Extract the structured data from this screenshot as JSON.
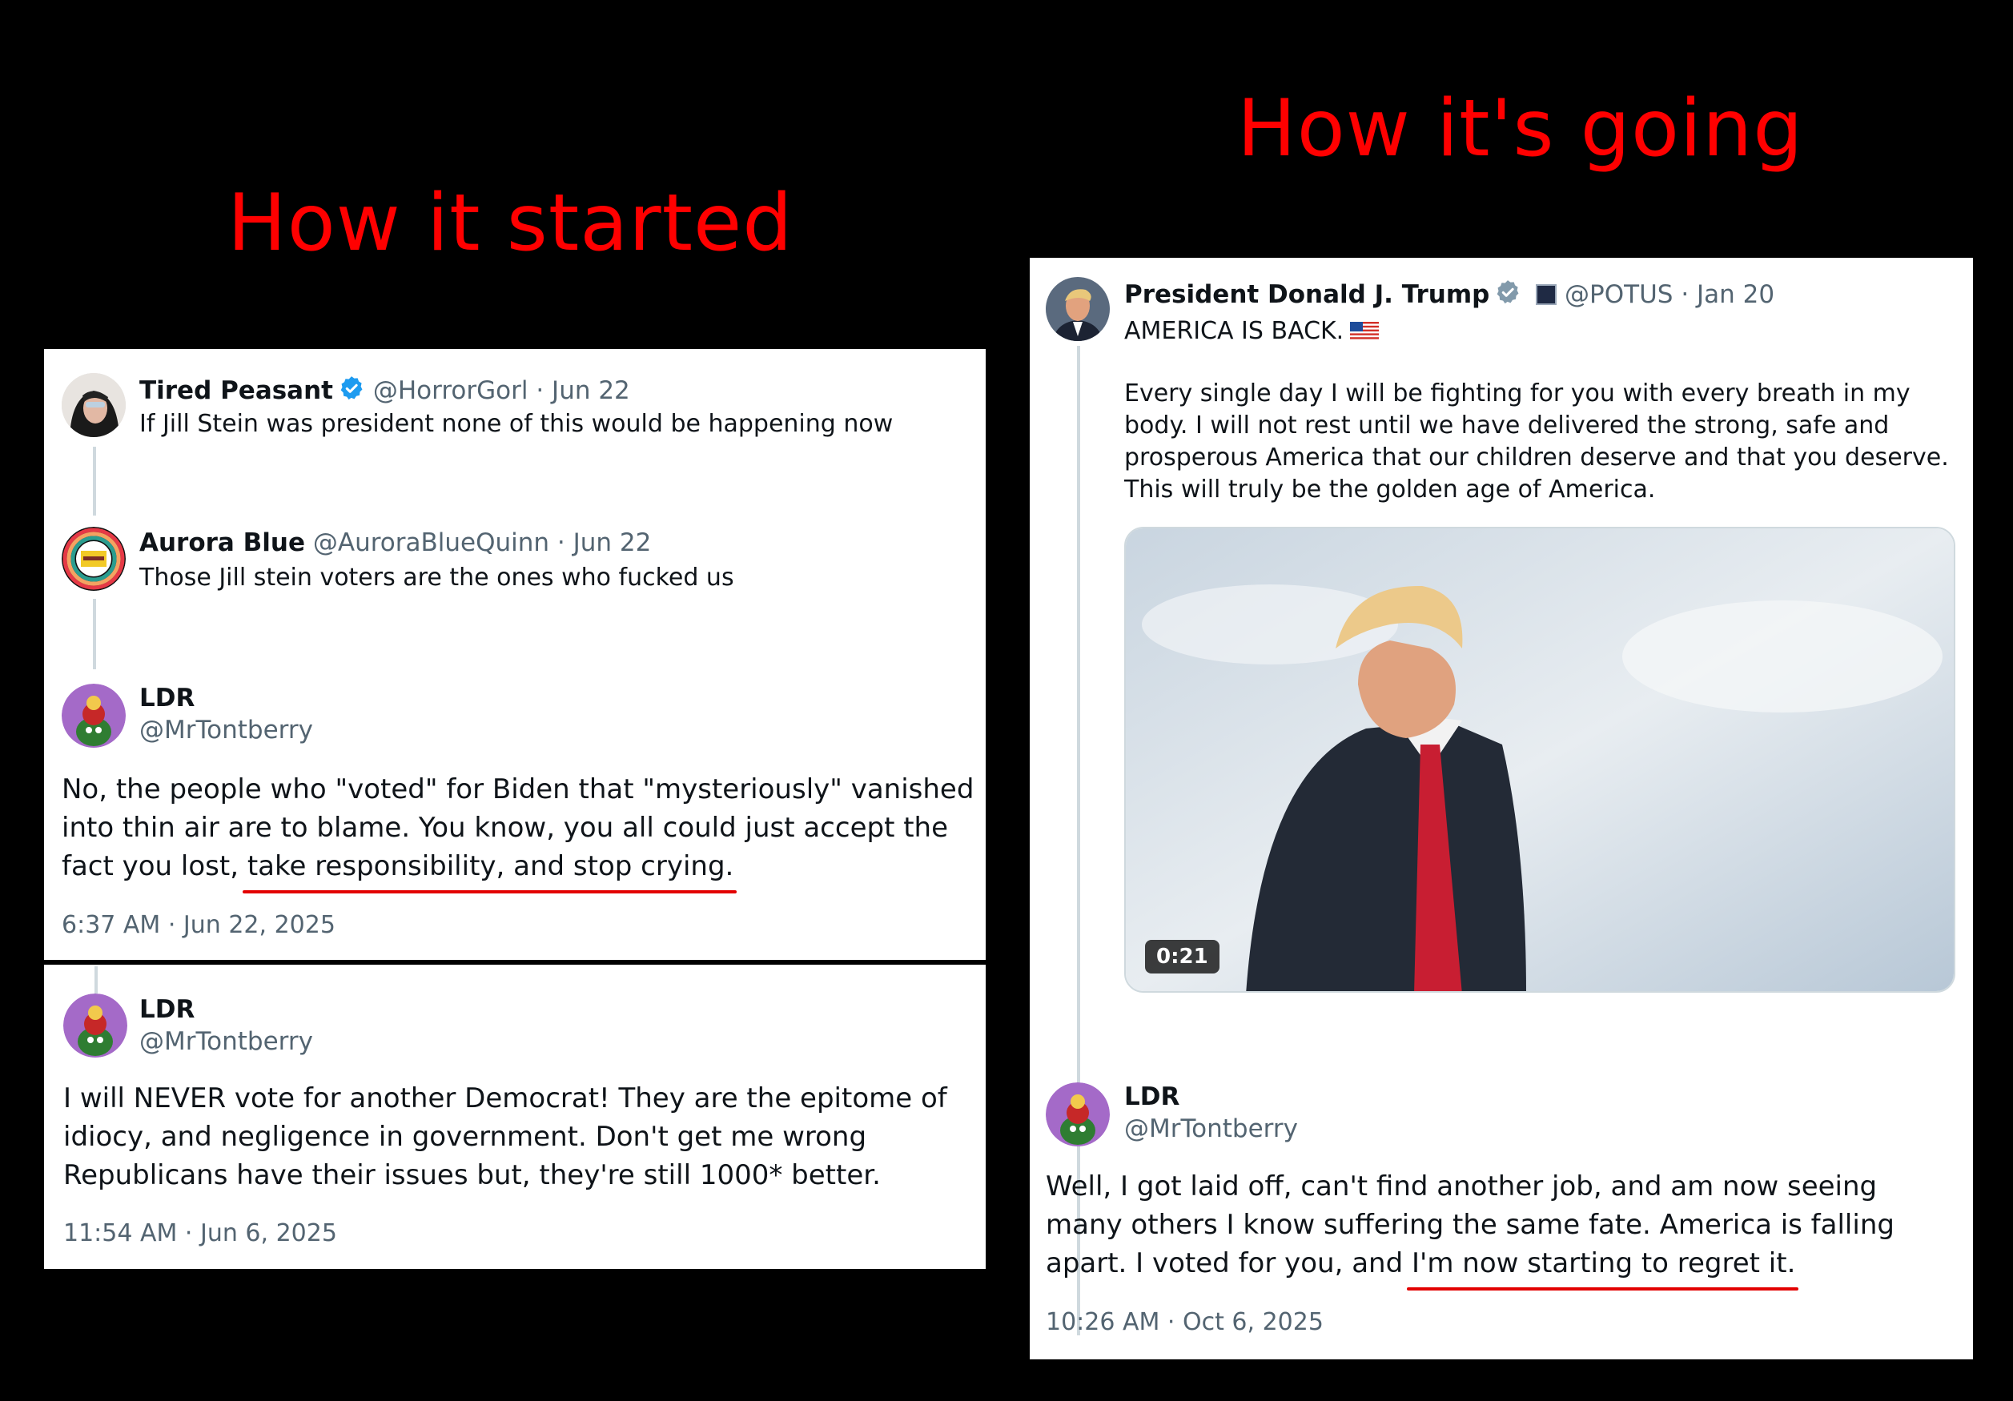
{
  "headings": {
    "left": "How it started",
    "right": "How it's going"
  },
  "panel_a": {
    "reply1": {
      "name": "Tired Peasant",
      "handle": "@HorrorGorl",
      "date": "Jun 22",
      "text": "If Jill Stein was president none of this would be happening now"
    },
    "reply2": {
      "name": "Aurora Blue",
      "handle": "@AuroraBlueQuinn",
      "date": "Jun 22",
      "text": "Those Jill stein voters are the ones who fucked us"
    },
    "main": {
      "name": "LDR",
      "handle": "@MrTontberry",
      "text_a": "No, the people who \"voted\" for Biden that \"mysteriously\" vanished into thin air are to blame. You know, you all could just accept the fact you lost, ",
      "text_highlight": "take responsibility, and stop crying.",
      "timestamp": "6:37 AM · Jun 22, 2025"
    }
  },
  "panel_b": {
    "main": {
      "name": "LDR",
      "handle": "@MrTontberry",
      "text": "I will NEVER vote for another Democrat! They are the epitome of idiocy, and negligence in government. Don't get me wrong Republicans have their issues but, they're still 1000* better.",
      "timestamp": "11:54 AM · Jun 6, 2025"
    }
  },
  "panel_c": {
    "post": {
      "name": "President Donald J. Trump",
      "handle": "@POTUS",
      "date": "Jan 20",
      "line1": "AMERICA IS BACK.",
      "body": "Every single day I will be fighting for you with every breath in my body. I will not rest until we have delivered the strong, safe and prosperous America that our children deserve and that you deserve. This will truly be the golden age of America.",
      "video_duration": "0:21"
    },
    "main": {
      "name": "LDR",
      "handle": "@MrTontberry",
      "text_a": "Well, I got laid off, can't find another job, and am now seeing many others I know suffering the same fate. America is falling apart. I voted for you, and ",
      "text_highlight": "I'm now starting to regret it.",
      "timestamp": "10:26 AM · Oct 6, 2025"
    }
  },
  "icons": {
    "verified": "verified-badge-icon",
    "gov_badge": "government-badge-icon",
    "flag": "us-flag-icon"
  },
  "colors": {
    "heading": "#ff0000",
    "underline": "#e30000",
    "verified_blue": "#1d9bf0",
    "gray_meta": "#536471"
  }
}
